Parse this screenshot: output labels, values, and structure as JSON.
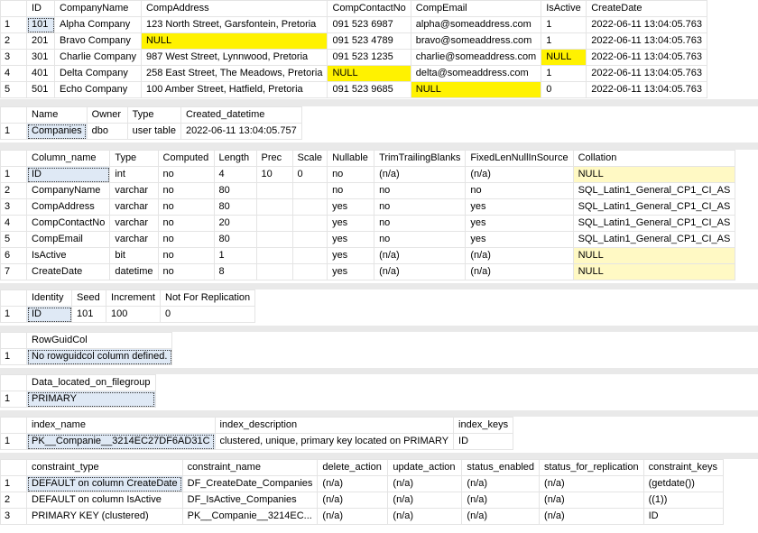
{
  "grids": [
    {
      "id": "g1",
      "columns": [
        "ID",
        "CompanyName",
        "CompAddress",
        "CompContactNo",
        "CompEmail",
        "IsActive",
        "CreateDate"
      ],
      "widths": [
        31,
        90,
        202,
        86,
        140,
        50,
        120
      ],
      "rows": [
        [
          "101",
          "Alpha Company",
          "123 North Street, Garsfontein, Pretoria",
          "091 523 6987",
          "alpha@someaddress.com",
          "1",
          "2022-06-11 13:04:05.763"
        ],
        [
          "201",
          "Bravo Company",
          "NULL",
          "091 523 4789",
          "bravo@someaddress.com",
          "1",
          "2022-06-11 13:04:05.763"
        ],
        [
          "301",
          "Charlie Company",
          "987 West Street,  Lynnwood, Pretoria",
          "091 523 1235",
          "charlie@someaddress.com",
          "NULL",
          "2022-06-11 13:04:05.763"
        ],
        [
          "401",
          "Delta Company",
          "258 East Street,  The Meadows, Pretoria",
          "NULL",
          "delta@someaddress.com",
          "1",
          "2022-06-11 13:04:05.763"
        ],
        [
          "501",
          "Echo Company",
          "100 Amber Street, Hatfield, Pretoria",
          "091 523 9685",
          "NULL",
          "0",
          "2022-06-11 13:04:05.763"
        ]
      ]
    },
    {
      "id": "g2",
      "columns": [
        "Name",
        "Owner",
        "Type",
        "Created_datetime"
      ],
      "widths": [
        66,
        45,
        58,
        130
      ],
      "rows": [
        [
          "Companies",
          "dbo",
          "user table",
          "2022-06-11 13:04:05.757"
        ]
      ]
    },
    {
      "id": "g3",
      "columns": [
        "Column_name",
        "Type",
        "Computed",
        "Length",
        "Prec",
        "Scale",
        "Nullable",
        "TrimTrailingBlanks",
        "FixedLenNullInSource",
        "Collation"
      ],
      "widths": [
        90,
        52,
        62,
        47,
        40,
        38,
        52,
        100,
        114,
        168
      ],
      "rows": [
        [
          "ID",
          "int",
          "no",
          "4",
          "10",
          "0",
          "no",
          "(n/a)",
          "(n/a)",
          "NULL"
        ],
        [
          "CompanyName",
          "varchar",
          "no",
          "80",
          "",
          "",
          "no",
          "no",
          "no",
          "SQL_Latin1_General_CP1_CI_AS"
        ],
        [
          "CompAddress",
          "varchar",
          "no",
          "80",
          "",
          "",
          "yes",
          "no",
          "yes",
          "SQL_Latin1_General_CP1_CI_AS"
        ],
        [
          "CompContactNo",
          "varchar",
          "no",
          "20",
          "",
          "",
          "yes",
          "no",
          "yes",
          "SQL_Latin1_General_CP1_CI_AS"
        ],
        [
          "CompEmail",
          "varchar",
          "no",
          "80",
          "",
          "",
          "yes",
          "no",
          "yes",
          "SQL_Latin1_General_CP1_CI_AS"
        ],
        [
          "IsActive",
          "bit",
          "no",
          "1",
          "",
          "",
          "yes",
          "(n/a)",
          "(n/a)",
          "NULL"
        ],
        [
          "CreateDate",
          "datetime",
          "no",
          "8",
          "",
          "",
          "yes",
          "(n/a)",
          "(n/a)",
          "NULL"
        ]
      ]
    },
    {
      "id": "g4",
      "columns": [
        "Identity",
        "Seed",
        "Increment",
        "Not For Replication"
      ],
      "widths": [
        50,
        38,
        60,
        97
      ],
      "rows": [
        [
          "ID",
          "101",
          "100",
          "0"
        ]
      ]
    },
    {
      "id": "g5",
      "columns": [
        "RowGuidCol"
      ],
      "widths": [
        158
      ],
      "rows": [
        [
          "No rowguidcol column defined."
        ]
      ]
    },
    {
      "id": "g6",
      "columns": [
        "Data_located_on_filegroup"
      ],
      "widths": [
        140
      ],
      "rows": [
        [
          "PRIMARY"
        ]
      ]
    },
    {
      "id": "g7",
      "columns": [
        "index_name",
        "index_description",
        "index_keys"
      ],
      "widths": [
        200,
        250,
        64
      ],
      "rows": [
        [
          "PK__Companie__3214EC27DF6AD31C",
          "clustered, unique, primary key located on PRIMARY",
          "ID"
        ]
      ]
    },
    {
      "id": "g8",
      "columns": [
        "constraint_type",
        "constraint_name",
        "delete_action",
        "update_action",
        "status_enabled",
        "status_for_replication",
        "constraint_keys"
      ],
      "widths": [
        170,
        142,
        78,
        82,
        82,
        112,
        88
      ],
      "rows": [
        [
          "DEFAULT on column CreateDate",
          "DF_CreateDate_Companies",
          "(n/a)",
          "(n/a)",
          "(n/a)",
          "(n/a)",
          "(getdate())"
        ],
        [
          "DEFAULT on column IsActive",
          "DF_IsActive_Companies",
          "(n/a)",
          "(n/a)",
          "(n/a)",
          "(n/a)",
          "((1))"
        ],
        [
          "PRIMARY KEY (clustered)",
          "PK__Companie__3214EC...",
          "(n/a)",
          "(n/a)",
          "(n/a)",
          "(n/a)",
          "ID"
        ]
      ]
    }
  ]
}
